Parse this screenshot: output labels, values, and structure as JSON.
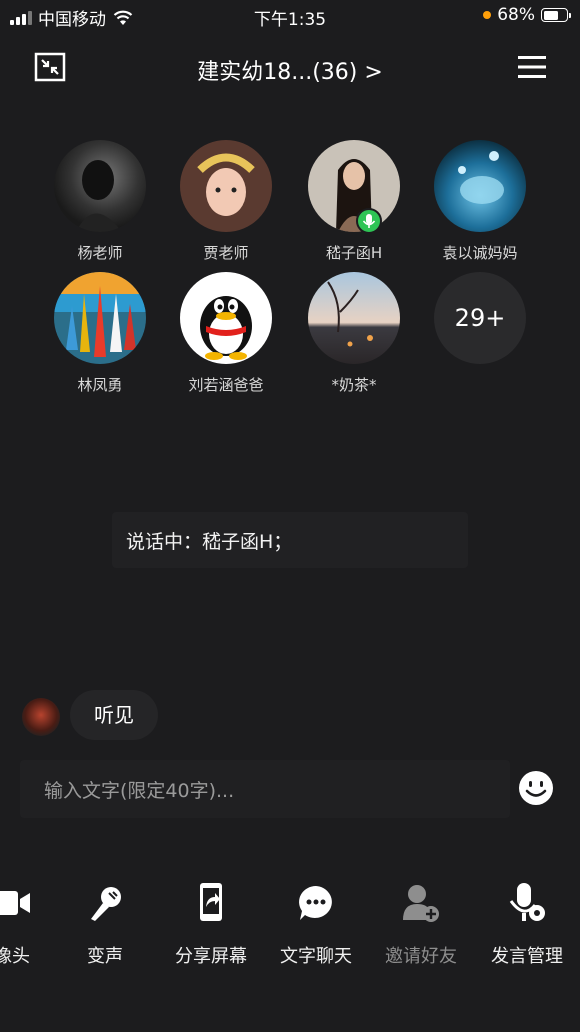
{
  "status_bar": {
    "carrier": "中国移动",
    "time": "下午1:35",
    "battery": "68%",
    "battery_level": 0.68
  },
  "header": {
    "title": "建实幼18...(36) >",
    "left_icon": "shrink-window-icon",
    "right_icon": "menu-icon"
  },
  "members": [
    {
      "name": "杨老师"
    },
    {
      "name": "贾老师"
    },
    {
      "name": "嵇子函H",
      "speaking": true
    },
    {
      "name": "袁以诚妈妈"
    },
    {
      "name": "林凤勇"
    },
    {
      "name": "刘若涵爸爸"
    },
    {
      "name": "*奶茶*"
    }
  ],
  "more_count": "29+",
  "speaking_text": "说话中：嵇子函H；",
  "chat": {
    "message": "听见"
  },
  "input": {
    "placeholder": "输入文字(限定40字)..."
  },
  "toolbar": [
    {
      "label": "像头",
      "icon": "camera-icon"
    },
    {
      "label": "变声",
      "icon": "voice-change-icon"
    },
    {
      "label": "分享屏幕",
      "icon": "share-screen-icon"
    },
    {
      "label": "文字聊天",
      "icon": "text-chat-icon"
    },
    {
      "label": "邀请好友",
      "icon": "invite-friend-icon",
      "disabled": true
    },
    {
      "label": "发言管理",
      "icon": "speech-manage-icon"
    }
  ],
  "colors": {
    "background": "#1c1c1e",
    "mic_badge": "#2ec455",
    "battery_dot": "#ff9f0a"
  }
}
